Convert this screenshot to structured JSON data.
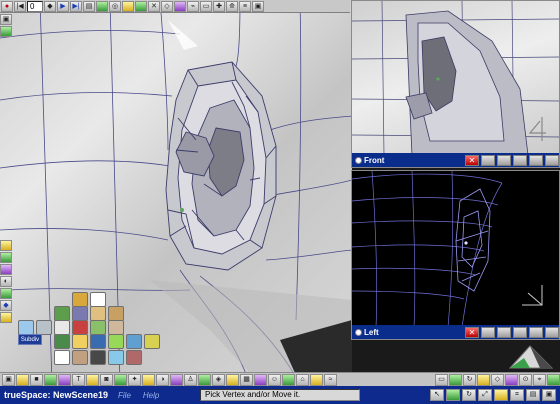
{
  "app": {
    "title": "trueSpace: NewScene19"
  },
  "toolbar": {
    "frame_value": "0",
    "buttons": [
      "record",
      "rewind",
      "prev-frame",
      "play",
      "next-frame",
      "last-frame",
      "render-settings",
      "undo",
      "glue",
      "scene",
      "tool-a",
      "tool-b",
      "tool-c",
      "tool-d",
      "tool-e",
      "tool-f",
      "tool-g",
      "tool-h",
      "tool-i",
      "tool-j"
    ]
  },
  "viewports": {
    "front": {
      "label": "Front"
    },
    "left": {
      "label": "Left"
    }
  },
  "status": {
    "menu": [
      "File",
      "Help"
    ],
    "hint": "Pick Vertex and/or Move it."
  },
  "palette": {
    "subdivision_label": "Subdiv"
  }
}
